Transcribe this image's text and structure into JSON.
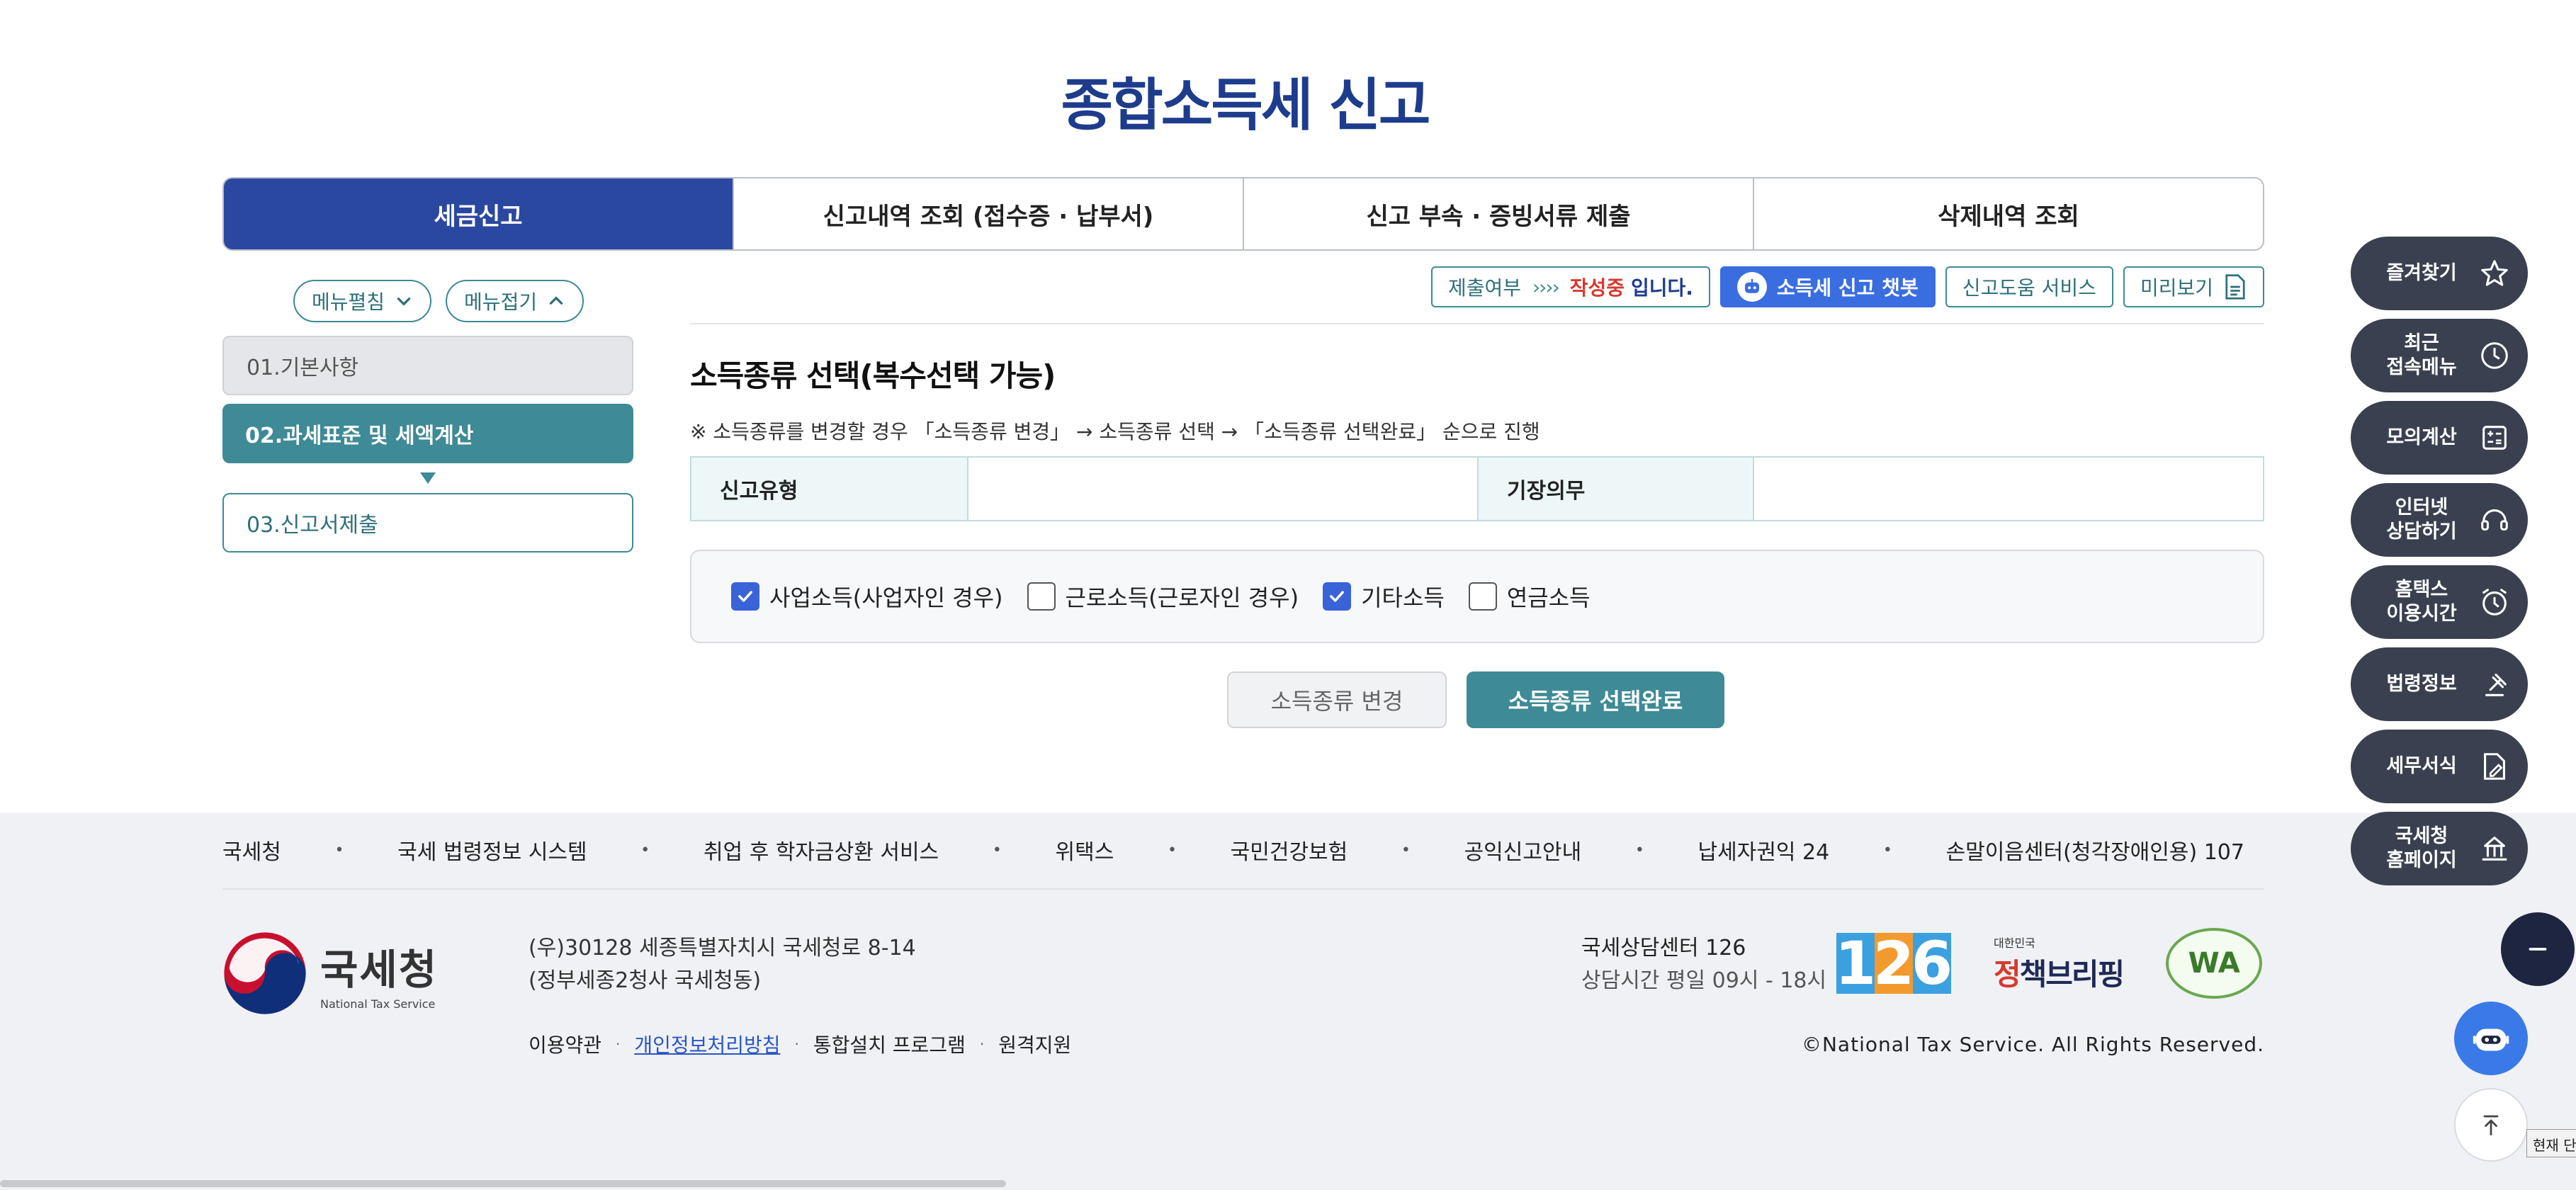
{
  "page": {
    "title": "종합소득세 신고"
  },
  "tabs": [
    "세금신고",
    "신고내역 조회 (접수증 · 납부서)",
    "신고 부속 · 증빙서류 제출",
    "삭제내역 조회"
  ],
  "menu": {
    "expand_label": "메뉴펼침",
    "collapse_label": "메뉴접기"
  },
  "steps": [
    "01.기본사항",
    "02.과세표준 및 세액계산",
    "03.신고서제출"
  ],
  "toolbar": {
    "status_label": "제출여부",
    "status_arrows": "››››",
    "status_value": "작성중",
    "status_suffix": "입니다.",
    "chatbot_label": "소득세 신고 챗봇",
    "help_label": "신고도움 서비스",
    "preview_label": "미리보기"
  },
  "section": {
    "title": "소득종류 선택(복수선택 가능)",
    "note": "※ 소득종류를 변경할 경우 「소득종류 변경」 → 소득종류 선택 → 「소득종류 선택완료」 순으로 진행"
  },
  "info_table": {
    "report_type_label": "신고유형",
    "report_type_value": "",
    "bookkeeping_label": "기장의무",
    "bookkeeping_value": ""
  },
  "income_types": [
    {
      "label": "사업소득(사업자인 경우)",
      "checked": true
    },
    {
      "label": "근로소득(근로자인 경우)",
      "checked": false
    },
    {
      "label": "기타소득",
      "checked": true
    },
    {
      "label": "연금소득",
      "checked": false
    }
  ],
  "actions": {
    "change_label": "소득종류 변경",
    "complete_label": "소득종류 선택완료"
  },
  "footer": {
    "links": [
      "국세청",
      "국세 법령정보 시스템",
      "취업 후 학자금상환 서비스",
      "위택스",
      "국민건강보험",
      "공익신고안내",
      "납세자권익 24",
      "손말이음센터(청각장애인용) 107"
    ],
    "logo_kr": "국세청",
    "logo_en": "National Tax Service",
    "address_line1": "(우)30128 세종특별자치시 국세청로 8-14",
    "address_line2": "(정부세종2청사 국세청동)",
    "bottom_links": [
      "이용약관",
      "개인정보처리방침",
      "통합설치 프로그램",
      "원격지원"
    ],
    "center_name": "국세상담센터 126",
    "center_hours": "상담시간 평일 09시 - 18시",
    "badge_126": [
      "1",
      "2",
      "6"
    ],
    "policy_small": "대한민국",
    "policy_large_a": "정",
    "policy_large_b": "책브리핑",
    "wa_label": "WA",
    "copyright": "©National Tax Service. All Rights Reserved."
  },
  "side_menu": [
    "즐겨찾기",
    "최근\n접속메뉴",
    "모의계산",
    "인터넷\n상담하기",
    "홈택스\n이용시간",
    "법령정보",
    "세무서식",
    "국세청\n홈페이지"
  ],
  "tooltip": "현재 단",
  "colors": {
    "primary": "#2b48a0",
    "teal": "#3e8a96",
    "title": "#1e3c8c",
    "alert": "#d63a2f",
    "side": "#3a4050"
  }
}
